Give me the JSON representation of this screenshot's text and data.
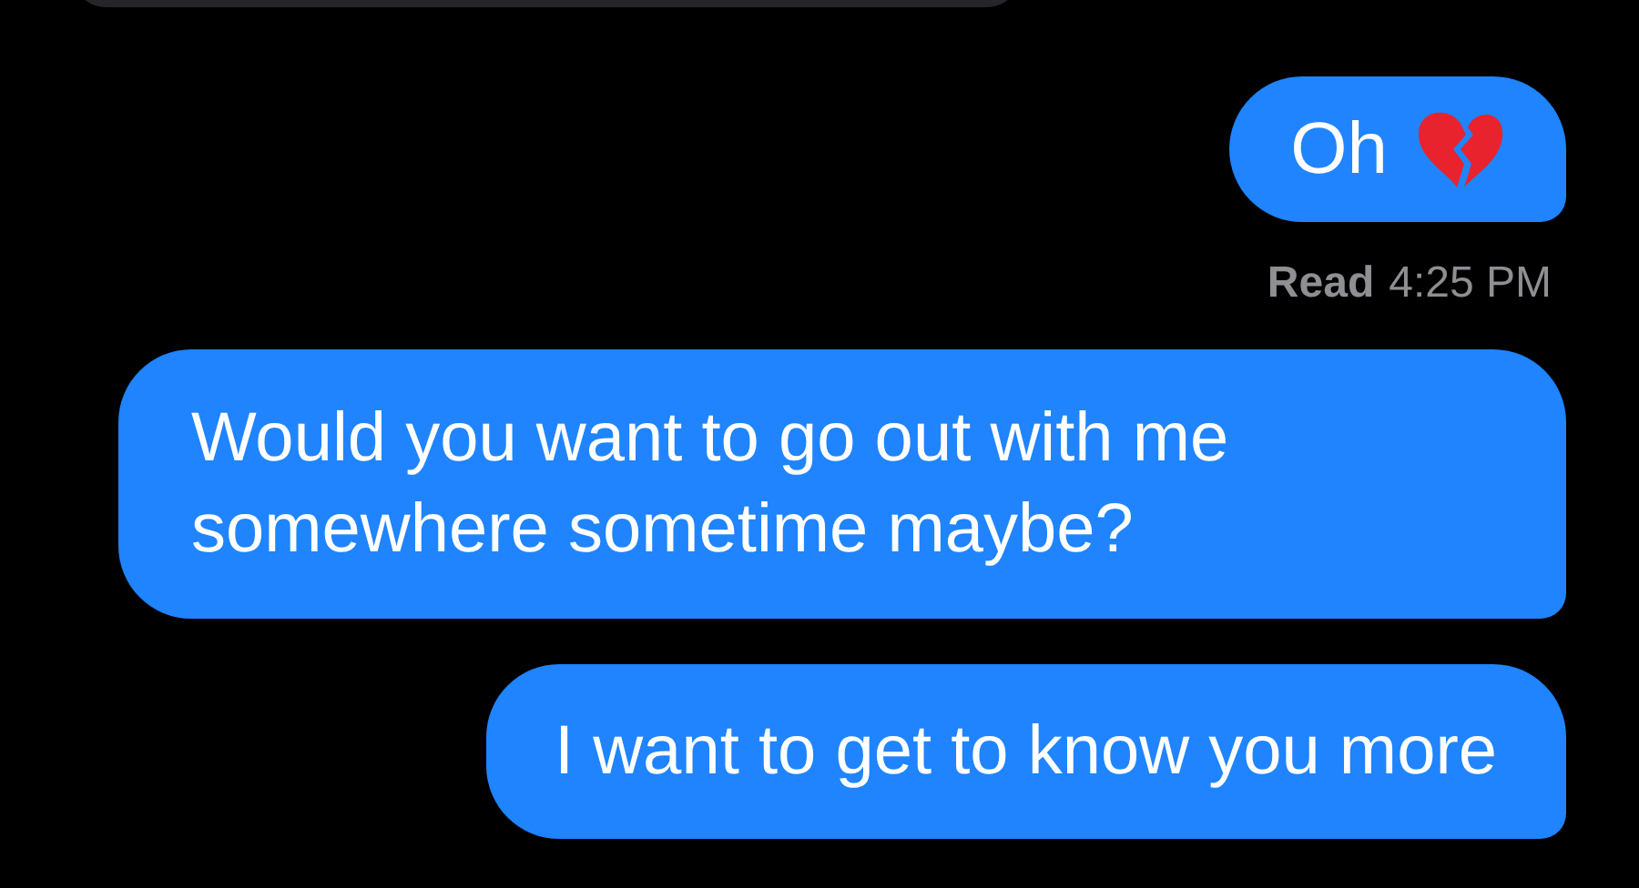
{
  "messages": [
    {
      "kind": "sent",
      "text": "Oh",
      "has_emoji": true
    },
    {
      "kind": "status",
      "label": "Read",
      "time": "4:25 PM"
    },
    {
      "kind": "sent",
      "text": "Would you want to go out with me somewhere sometime maybe?",
      "has_emoji": false
    },
    {
      "kind": "sent",
      "text": "I want to get to know you more",
      "has_emoji": false
    }
  ]
}
